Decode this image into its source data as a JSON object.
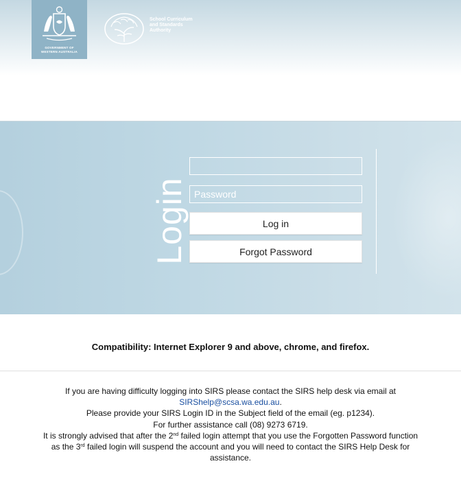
{
  "header": {
    "gov_logo_text": [
      "GOVERNMENT OF",
      "WESTERN AUSTRALIA"
    ],
    "authority_name": [
      "School Curriculum",
      "and Standards",
      "Authority"
    ]
  },
  "login": {
    "title": "Login",
    "username_value": "",
    "password_placeholder": "Password",
    "login_button": "Log in",
    "forgot_button": "Forgot Password"
  },
  "compatibility": "Compatibility: Internet Explorer 9 and above, chrome, and firefox.",
  "help": {
    "line1": "If you are having difficulty logging into SIRS please contact the SIRS help desk via email at",
    "email": "SIRShelp@scsa.wa.edu.au",
    "email_suffix": ".",
    "line3": "Please provide your SIRS Login ID in the Subject field of the email (eg. p1234).",
    "line4": "For further assistance call (08) 9273 6719.",
    "line5_a": "It is strongly advised that after the 2",
    "line5_sup": "nd",
    "line5_b": " failed login attempt that you use the Forgotten Password function",
    "line6_a": "as the 3",
    "line6_sup": "rd",
    "line6_b": " failed login will suspend the account and you will need to contact the SIRS Help Desk for",
    "line7": "assistance."
  },
  "colors": {
    "band": "#bfd8e4",
    "gov_logo_bg": "#8fb3c6",
    "link": "#1a4fa0"
  }
}
